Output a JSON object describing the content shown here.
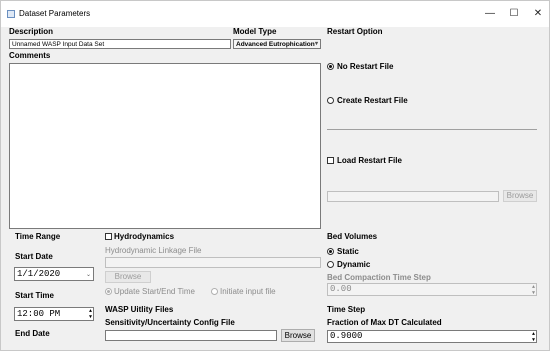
{
  "window": {
    "title": "Dataset Parameters",
    "minimize": "—",
    "maximize": "☐",
    "close": "✕"
  },
  "description": {
    "label": "Description",
    "value": "Unnamed WASP Input Data Set"
  },
  "model_type": {
    "label": "Model Type",
    "value": "Advanced Eutrophication"
  },
  "comments": {
    "label": "Comments",
    "value": ""
  },
  "restart": {
    "label": "Restart Option",
    "no_restart": "No Restart File",
    "create_restart": "Create Restart File",
    "load_restart": "Load Restart File",
    "browse": "Browse"
  },
  "time_range": {
    "label": "Time Range",
    "start_date_label": "Start Date",
    "start_date": "1/1/2020",
    "start_time_label": "Start Time",
    "start_time": "12:00  PM",
    "end_date_label": "End Date"
  },
  "hydrodynamics": {
    "checkbox_label": "Hydrodynamics",
    "linkage_label": "Hydrodynamic Linkage File",
    "browse": "Browse",
    "update_label": "Update Start/End Time",
    "initiate_label": "Initiate input file"
  },
  "utility": {
    "label": "WASP Uitlity Files",
    "sensitivity_label": "Sensitivity/Uncertainty Config File",
    "browse": "Browse"
  },
  "bed_volumes": {
    "label": "Bed Volumes",
    "static": "Static",
    "dynamic": "Dynamic",
    "compaction_label": "Bed Compaction Time Step",
    "compaction_value": "0.00"
  },
  "time_step": {
    "label": "Time Step",
    "fraction_label": "Fraction of Max DT Calculated",
    "fraction_value": "0.9000"
  }
}
